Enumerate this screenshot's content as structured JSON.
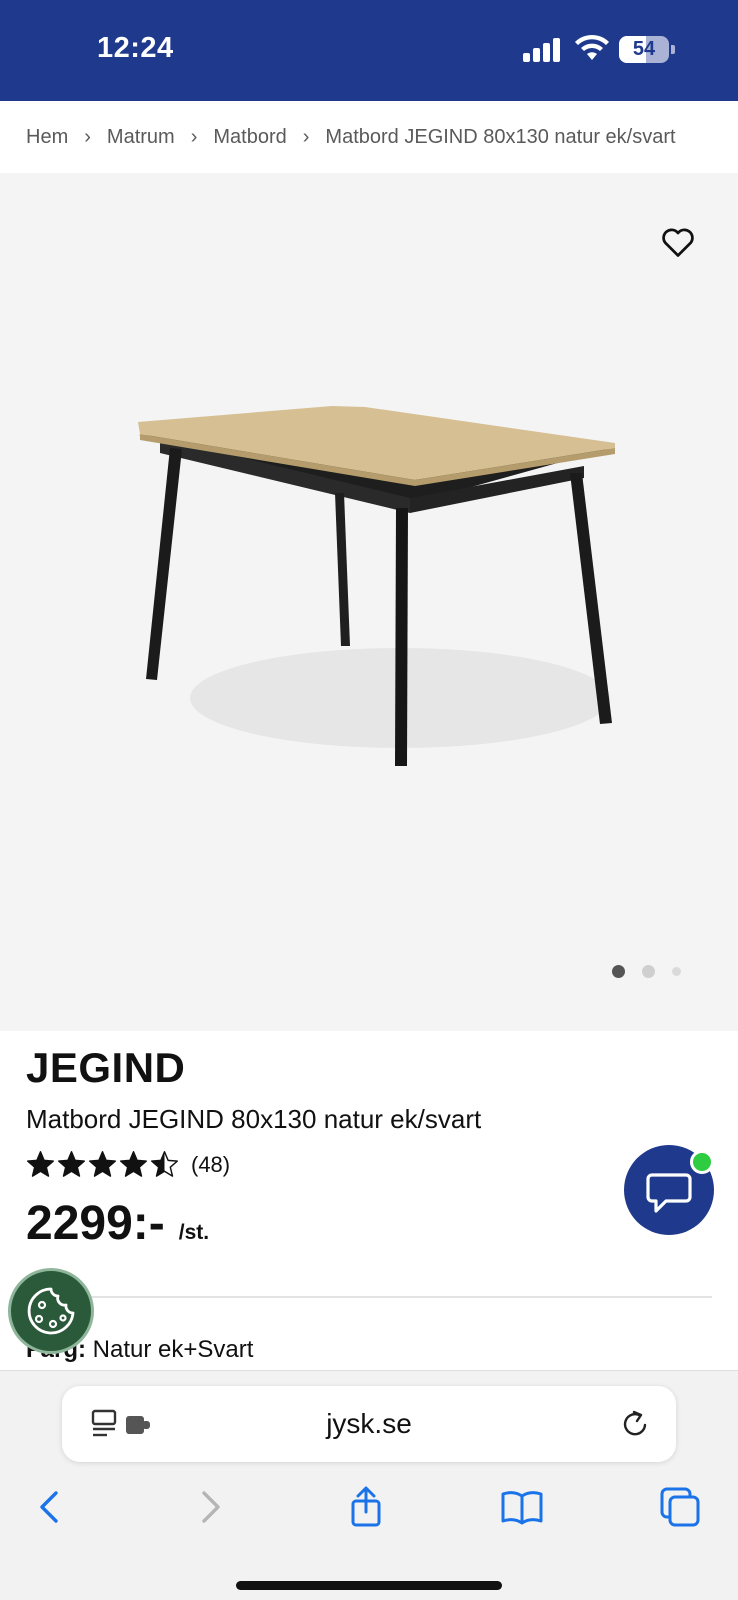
{
  "status_bar": {
    "time": "12:24",
    "battery": "54",
    "battery_level": 0.54,
    "color": "#1f3a8c"
  },
  "breadcrumb": {
    "items": [
      "Hem",
      "Matrum",
      "Matbord",
      "Matbord JEGIND 80x130 natur ek/svart"
    ],
    "separator": "›"
  },
  "gallery": {
    "icons": [
      "heart-icon"
    ],
    "current_index": 1,
    "total_images": 3,
    "background": "#f4f4f4"
  },
  "product": {
    "brand": "JEGIND",
    "title": "Matbord JEGIND 80x130 natur ek/svart",
    "rating": 4.5,
    "rating_count": "(48)",
    "price": "2299:-",
    "price_unit": "/st.",
    "color_label": "Färg:",
    "color_value": "Natur ek+Svart"
  },
  "floating": {
    "chat_icon": "chat-bubble-icon",
    "chat_color": "#1f3a8c",
    "online_color": "#2ecc40",
    "cookie_icon": "cookie-icon",
    "cookie_color": "#2b5a3a"
  },
  "browser": {
    "url": "jysk.se",
    "icons": [
      "reader-extensions-icon",
      "reload-icon",
      "back-icon",
      "forward-icon",
      "share-icon",
      "bookmarks-icon",
      "tabs-icon"
    ],
    "accent": "#1a73e8"
  }
}
